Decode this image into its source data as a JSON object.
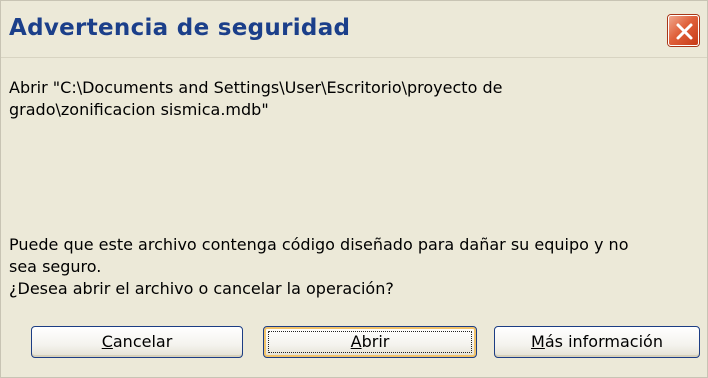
{
  "dialog": {
    "title": "Advertencia de seguridad",
    "close_icon": "close-icon",
    "message_line1": "Abrir \"C:\\Documents and Settings\\User\\Escritorio\\proyecto de",
    "message_line2": "grado\\zonificacion sismica.mdb\"",
    "warning_line1": "Puede que este archivo contenga código diseñado para dañar su equipo y no",
    "warning_line2": "sea seguro.",
    "question": "¿Desea abrir el archivo o cancelar la operación?",
    "accent_color": "#1b3f8a",
    "close_color": "#e0613b"
  },
  "buttons": {
    "cancel": {
      "mnemonic": "C",
      "rest": "ancelar"
    },
    "open": {
      "mnemonic": "A",
      "rest": "brir"
    },
    "more_info": {
      "mnemonic": "M",
      "rest": "ás información"
    }
  }
}
